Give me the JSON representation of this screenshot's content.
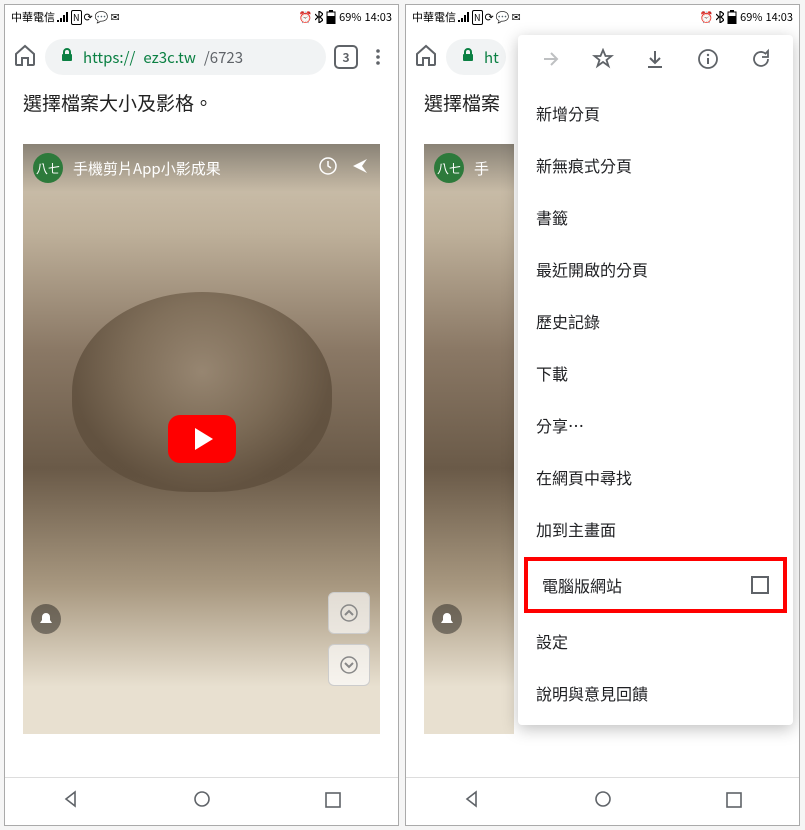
{
  "status": {
    "carrier": "中華電信",
    "battery_pct": "69%",
    "time": "14:03"
  },
  "chrome": {
    "url_secure": "https://",
    "url_host": "ez3c.tw",
    "url_path": "/6723",
    "tab_count": "3"
  },
  "page": {
    "text_full": "選擇檔案大小及影格。",
    "text_cut": "選擇檔案"
  },
  "video": {
    "channel_badge": "八七",
    "title_full": "手機剪片App小影成果",
    "title_cut": "手"
  },
  "menu": {
    "items": [
      "新增分頁",
      "新無痕式分頁",
      "書籤",
      "最近開啟的分頁",
      "歷史記錄",
      "下載",
      "分享…",
      "在網頁中尋找",
      "加到主畫面"
    ],
    "desktop_site": "電腦版網站",
    "settings": "設定",
    "help": "說明與意見回饋"
  }
}
